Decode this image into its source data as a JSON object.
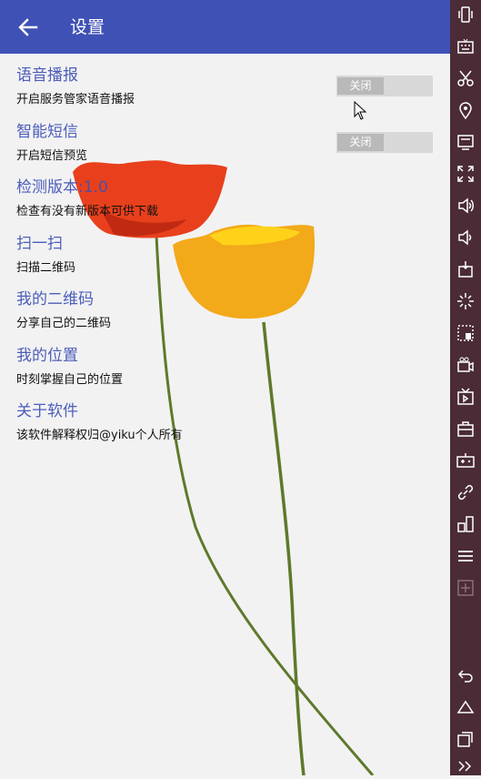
{
  "appbar": {
    "title": "设置"
  },
  "items": [
    {
      "heading": "语音播报",
      "sub": "开启服务管家语音播报",
      "toggle": "关闭"
    },
    {
      "heading": "智能短信",
      "sub": "开启短信预览",
      "toggle": "关闭"
    },
    {
      "heading": "检测版本:1.0",
      "sub": "检查有没有新版本可供下载"
    },
    {
      "heading": "扫一扫",
      "sub": "扫描二维码"
    },
    {
      "heading": "我的二维码",
      "sub": "分享自己的二维码"
    },
    {
      "heading": "我的位置",
      "sub": "时刻掌握自己的位置"
    },
    {
      "heading": "关于软件",
      "sub": "该软件解释权归@yiku个人所有"
    }
  ],
  "colors": {
    "primary": "#3f51b5",
    "sidebar": "#4a2b36",
    "poppy_red": "#e8401c",
    "poppy_yellow": "#f2a91a"
  },
  "sidebar_icons": [
    "vibrate-icon",
    "keyboard-icon",
    "scissors-icon",
    "location-icon",
    "screen-icon",
    "fullscreen-icon",
    "volume-up-icon",
    "volume-down-icon",
    "apk-install-icon",
    "loading-icon",
    "screenshot-icon",
    "video-record-icon",
    "tv-icon",
    "toolbox-icon",
    "gamepad-icon",
    "link-icon",
    "resize-icon",
    "menu-icon",
    "add-icon",
    "back-icon",
    "home-icon",
    "recents-icon",
    "more-icon"
  ]
}
